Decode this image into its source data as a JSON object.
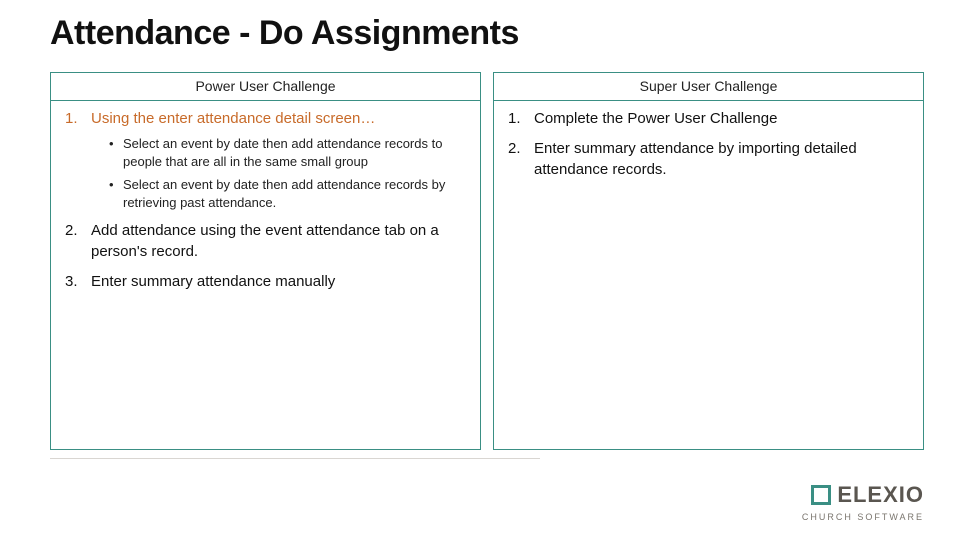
{
  "title": "Attendance - Do Assignments",
  "columns": {
    "left": {
      "heading": "Power User Challenge",
      "items": [
        {
          "text": "Using the enter attendance detail screen…",
          "highlight": true,
          "sub": [
            "Select an event by date then add attendance records to people that are all in the same small group",
            "Select an event by date then add attendance records by retrieving past attendance."
          ]
        },
        {
          "text": "Add attendance using the event attendance tab on a person's record.",
          "highlight": false
        },
        {
          "text": "Enter summary attendance manually",
          "highlight": false
        }
      ]
    },
    "right": {
      "heading": "Super User Challenge",
      "items": [
        {
          "text": "Complete the Power User Challenge",
          "highlight": false
        },
        {
          "text": "Enter summary attendance by importing detailed attendance records.",
          "highlight": false
        }
      ]
    }
  },
  "logo": {
    "type": "ELEXIO",
    "sub": "CHURCH SOFTWARE"
  }
}
